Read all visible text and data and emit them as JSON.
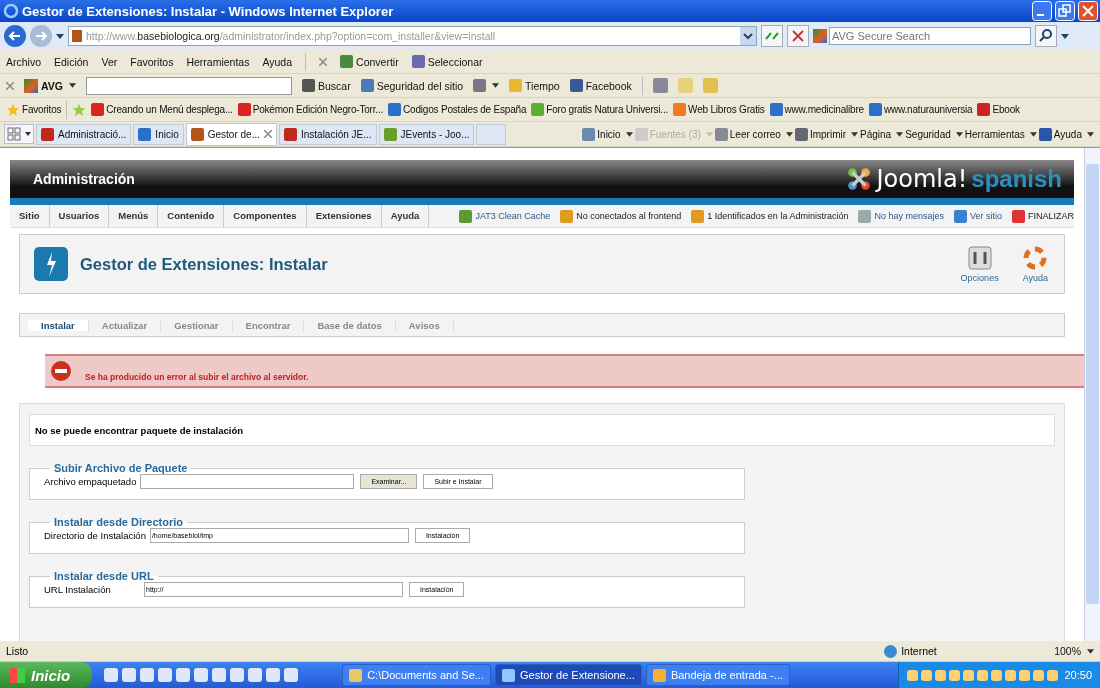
{
  "window": {
    "title": "Gestor de Extensiones: Instalar - Windows Internet Explorer"
  },
  "address_bar": {
    "prefix": "http://www.",
    "domain": "basebiologica.org",
    "path": "/administrator/index.php?option=com_installer&view=install"
  },
  "search": {
    "placeholder": "AVG Secure Search"
  },
  "menu": [
    "Archivo",
    "Edición",
    "Ver",
    "Favoritos",
    "Herramientas",
    "Ayuda"
  ],
  "command_bar": [
    "Convertir",
    "Seleccionar"
  ],
  "avg_toolbar": {
    "brand": "AVG",
    "buttons": [
      {
        "label": "Buscar",
        "kind": "search"
      },
      {
        "label": "Seguridad del sitio",
        "kind": "shield"
      },
      {
        "kind": "trash"
      },
      {
        "label": "Tiempo",
        "kind": "weather"
      },
      {
        "label": "Facebook",
        "kind": "facebook"
      }
    ]
  },
  "favorites": {
    "label": "Favoritos",
    "items": [
      {
        "label": "Creando un Menú desplega...",
        "kind": "video"
      },
      {
        "label": "Pokémon Edición Negro-Torr...",
        "kind": "video"
      },
      {
        "label": "Codigos Postales de España",
        "kind": "ie"
      },
      {
        "label": "Foro gratis  Natura Universi...",
        "kind": "chat"
      },
      {
        "label": "Web Libros Gratis",
        "kind": "blog"
      },
      {
        "label": "www.medicinalibre",
        "kind": "ie"
      },
      {
        "label": "www.naturauniversia",
        "kind": "ie"
      },
      {
        "label": "Ebook",
        "kind": "jam"
      }
    ]
  },
  "tabs": [
    {
      "label": "Administració...",
      "kind": "w",
      "selected": false
    },
    {
      "label": "Inicio",
      "kind": "ie",
      "selected": false
    },
    {
      "label": "Gestor de...",
      "kind": "page",
      "selected": true
    },
    {
      "label": "Instalación JE...",
      "kind": "w",
      "selected": false
    },
    {
      "label": "JEvents - Joo...",
      "kind": "joomla",
      "selected": false
    }
  ],
  "commands": [
    {
      "label": "Inicio",
      "kind": "home",
      "disabled": false
    },
    {
      "label": "Fuentes (3)",
      "kind": "feed",
      "disabled": true
    },
    {
      "label": "Leer correo",
      "kind": "mail",
      "disabled": false
    },
    {
      "label": "Imprimir",
      "kind": "print",
      "disabled": false
    },
    {
      "label": "Página",
      "kind": "none",
      "disabled": false
    },
    {
      "label": "Seguridad",
      "kind": "none",
      "disabled": false
    },
    {
      "label": "Herramientas",
      "kind": "none",
      "disabled": false
    },
    {
      "label": "Ayuda",
      "kind": "help",
      "disabled": false
    }
  ],
  "joomla": {
    "header": "Administración",
    "logo": "Joomla!",
    "logo_sub": "spanish",
    "menu": [
      "Sitio",
      "Usuarios",
      "Menús",
      "Contenido",
      "Componentes",
      "Extensiones",
      "Ayuda"
    ],
    "status": [
      {
        "label": "JAT3 Clean Cache",
        "kind": "cache"
      },
      {
        "label": "No conectados al frontend",
        "kind": "users"
      },
      {
        "label": "1 Identificados en la Administración",
        "kind": "users"
      },
      {
        "label": "No hay mensajes",
        "kind": "mail"
      },
      {
        "label": "Ver sitio",
        "kind": "screen"
      },
      {
        "label": "FINALIZAR",
        "kind": "logout"
      }
    ],
    "title": "Gestor de Extensiones: Instalar",
    "toolbar": [
      {
        "label": "Opciones",
        "kind": "options"
      },
      {
        "label": "Ayuda",
        "kind": "help"
      }
    ],
    "subtabs": [
      {
        "label": "Instalar",
        "selected": true
      },
      {
        "label": "Actualizar",
        "selected": false
      },
      {
        "label": "Gestionar",
        "selected": false
      },
      {
        "label": "Encontrar",
        "selected": false
      },
      {
        "label": "Base de datos",
        "selected": false
      },
      {
        "label": "Avisos",
        "selected": false
      }
    ],
    "error": "Se ha producido un error al subir el archivo al servidor.",
    "notice": "No se puede encontrar paquete de instalación",
    "fieldsets": [
      {
        "legend": "Subir Archivo de Paquete",
        "label": "Archivo empaquetado",
        "kind": "file",
        "buttons": [
          "Examinar...",
          "Subir e Instalar"
        ]
      },
      {
        "legend": "Instalar desde Directorio",
        "label": "Directorio de Instalación",
        "kind": "text",
        "value": "/home/basebiol/tmp",
        "buttons": [
          "Instalación"
        ]
      },
      {
        "legend": "Instalar desde URL",
        "label": "URL Instalación",
        "kind": "text",
        "value": "http://",
        "buttons": [
          "Instalación"
        ]
      }
    ]
  },
  "status_bar": {
    "text": "Listo",
    "zone": "Internet",
    "zoom": "100%"
  },
  "taskbar": {
    "start": "Inicio",
    "tasks": [
      {
        "label": "C:\\Documents and Se...",
        "kind": "folder",
        "selected": false
      },
      {
        "label": "Gestor de Extensione...",
        "kind": "ie",
        "selected": true
      },
      {
        "label": "Bandeja de entrada -...",
        "kind": "mail",
        "selected": false
      }
    ],
    "clock": "20:50"
  }
}
